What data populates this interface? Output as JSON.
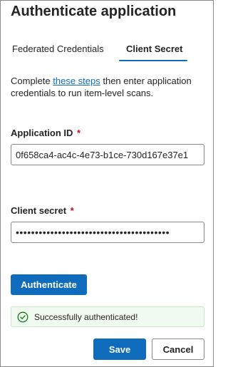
{
  "dialog": {
    "title": "Authenticate application"
  },
  "tabs": [
    {
      "label": "Federated Credentials",
      "selected": false
    },
    {
      "label": "Client Secret",
      "selected": true
    }
  ],
  "description": {
    "prefix": "Complete ",
    "link_text": "these steps",
    "suffix": " then enter application credentials to run item-level scans."
  },
  "fields": {
    "application_id": {
      "label": "Application ID",
      "required_marker": "*",
      "value": "0f658ca4-ac4c-4e73-b1ce-730d167e37e1"
    },
    "client_secret": {
      "label": "Client secret",
      "required_marker": "*",
      "value": "••••••••••••••••••••••••••••••••••••••••"
    }
  },
  "authenticate_button": {
    "label": "Authenticate"
  },
  "status": {
    "message": "Successfully authenticated!",
    "icon": "checkmark-circle-icon",
    "color": "#107c10"
  },
  "footer": {
    "save_label": "Save",
    "cancel_label": "Cancel"
  },
  "colors": {
    "accent": "#0f6cbd",
    "required": "#c50f1f",
    "success_bg": "#f1faf1"
  }
}
